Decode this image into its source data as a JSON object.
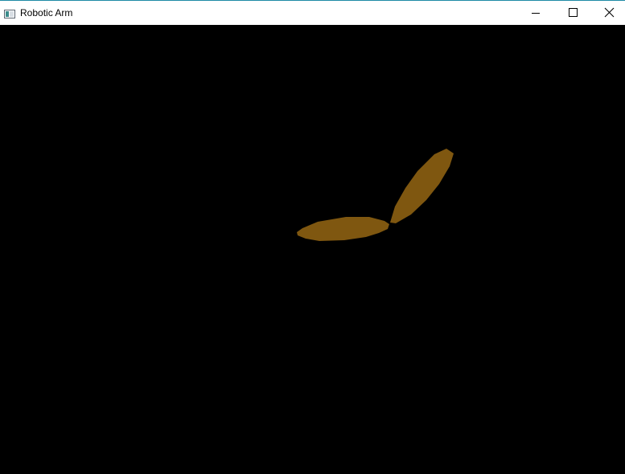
{
  "window": {
    "title": "Robotic Arm",
    "icon": "application-window-icon",
    "controls": {
      "minimize": "minimize-icon",
      "maximize": "maximize-icon",
      "close": "close-icon"
    }
  },
  "scene": {
    "background": "#000000",
    "segment_color": "#7f5710",
    "segments": [
      "upper-arm",
      "forearm"
    ]
  }
}
